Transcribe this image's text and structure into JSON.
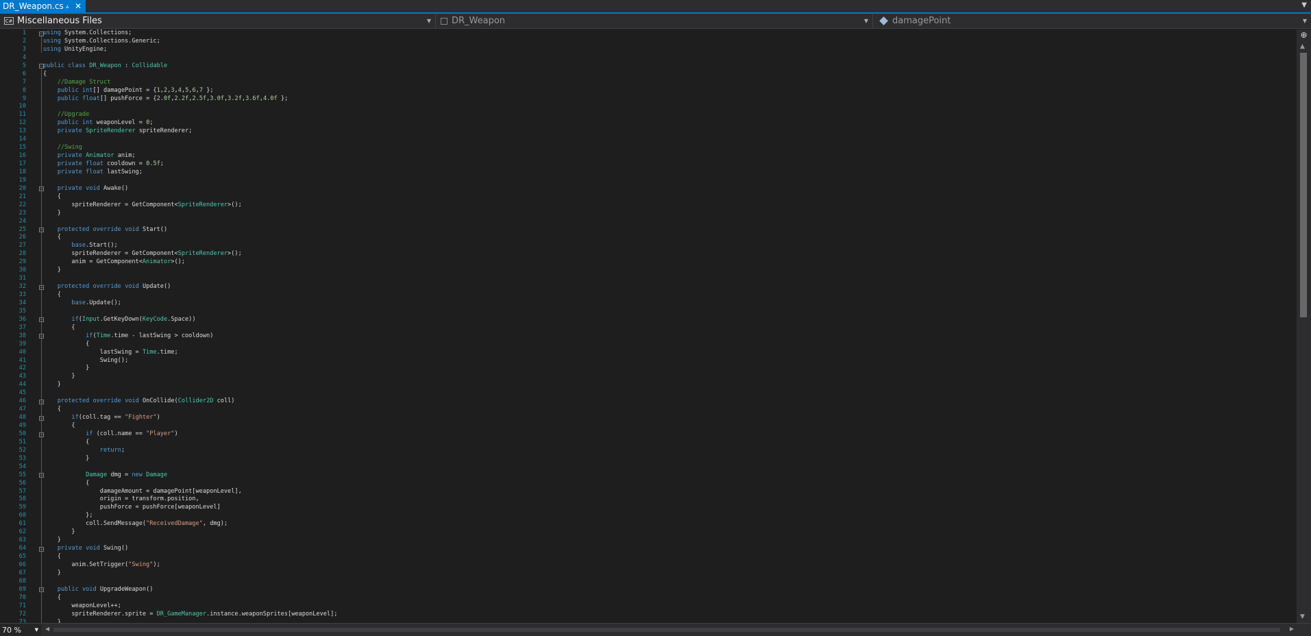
{
  "tab": {
    "title": "DR_Weapon.cs",
    "pin_icon": "pin-icon",
    "close_icon": "close-icon"
  },
  "nav": {
    "project": "Miscellaneous Files",
    "type": "DR_Weapon",
    "member": "damagePoint"
  },
  "zoom": {
    "value": "70 %"
  },
  "colors": {
    "accent": "#007acc",
    "keyword": "#569cd6",
    "type": "#4ec9b0",
    "comment": "#57a64a",
    "number": "#b5cea8",
    "string": "#d69d85",
    "line_number": "#2b91af"
  },
  "line_numbers": [
    "1",
    "2",
    "3",
    "4",
    "5",
    "6",
    "7",
    "8",
    "9",
    "10",
    "11",
    "12",
    "13",
    "14",
    "15",
    "16",
    "17",
    "18",
    "19",
    "20",
    "21",
    "22",
    "23",
    "24",
    "25",
    "26",
    "27",
    "28",
    "29",
    "30",
    "31",
    "32",
    "33",
    "34",
    "35",
    "36",
    "37",
    "38",
    "39",
    "40",
    "41",
    "42",
    "43",
    "44",
    "45",
    "46",
    "47",
    "48",
    "49",
    "50",
    "51",
    "52",
    "53",
    "54",
    "55",
    "56",
    "57",
    "58",
    "59",
    "60",
    "61",
    "62",
    "63",
    "64",
    "65",
    "66",
    "67",
    "68",
    "69",
    "70",
    "71",
    "72",
    "73"
  ],
  "code_lines": [
    [
      [
        "kw",
        "using"
      ],
      [
        "t",
        " System.Collections;"
      ]
    ],
    [
      [
        "kw",
        "using"
      ],
      [
        "t",
        " System.Collections.Generic;"
      ]
    ],
    [
      [
        "kw",
        "using"
      ],
      [
        "t",
        " UnityEngine;"
      ]
    ],
    [],
    [
      [
        "kw",
        "public"
      ],
      [
        "t",
        " "
      ],
      [
        "kw",
        "class"
      ],
      [
        "t",
        " "
      ],
      [
        "ty",
        "DR_Weapon"
      ],
      [
        "t",
        " : "
      ],
      [
        "ty",
        "Collidable"
      ]
    ],
    [
      [
        "t",
        "{"
      ]
    ],
    [
      [
        "t",
        "    "
      ],
      [
        "cm",
        "//Damage Struct"
      ]
    ],
    [
      [
        "t",
        "    "
      ],
      [
        "kw",
        "public"
      ],
      [
        "t",
        " "
      ],
      [
        "kw",
        "int"
      ],
      [
        "t",
        "[] damagePoint = {"
      ],
      [
        "nm",
        "1"
      ],
      [
        "t",
        ","
      ],
      [
        "nm",
        "2"
      ],
      [
        "t",
        ","
      ],
      [
        "nm",
        "3"
      ],
      [
        "t",
        ","
      ],
      [
        "nm",
        "4"
      ],
      [
        "t",
        ","
      ],
      [
        "nm",
        "5"
      ],
      [
        "t",
        ","
      ],
      [
        "nm",
        "6"
      ],
      [
        "t",
        ","
      ],
      [
        "nm",
        "7"
      ],
      [
        "t",
        " };"
      ]
    ],
    [
      [
        "t",
        "    "
      ],
      [
        "kw",
        "public"
      ],
      [
        "t",
        " "
      ],
      [
        "kw",
        "float"
      ],
      [
        "t",
        "[] pushForce = {"
      ],
      [
        "nm",
        "2.0f"
      ],
      [
        "t",
        ","
      ],
      [
        "nm",
        "2.2f"
      ],
      [
        "t",
        ","
      ],
      [
        "nm",
        "2.5f"
      ],
      [
        "t",
        ","
      ],
      [
        "nm",
        "3.0f"
      ],
      [
        "t",
        ","
      ],
      [
        "nm",
        "3.2f"
      ],
      [
        "t",
        ","
      ],
      [
        "nm",
        "3.6f"
      ],
      [
        "t",
        ","
      ],
      [
        "nm",
        "4.0f"
      ],
      [
        "t",
        " };"
      ]
    ],
    [],
    [
      [
        "t",
        "    "
      ],
      [
        "cm",
        "//Upgrade"
      ]
    ],
    [
      [
        "t",
        "    "
      ],
      [
        "kw",
        "public"
      ],
      [
        "t",
        " "
      ],
      [
        "kw",
        "int"
      ],
      [
        "t",
        " weaponLevel = "
      ],
      [
        "nm",
        "0"
      ],
      [
        "t",
        ";"
      ]
    ],
    [
      [
        "t",
        "    "
      ],
      [
        "kw",
        "private"
      ],
      [
        "t",
        " "
      ],
      [
        "ty",
        "SpriteRenderer"
      ],
      [
        "t",
        " spriteRenderer;"
      ]
    ],
    [],
    [
      [
        "t",
        "    "
      ],
      [
        "cm",
        "//Swing"
      ]
    ],
    [
      [
        "t",
        "    "
      ],
      [
        "kw",
        "private"
      ],
      [
        "t",
        " "
      ],
      [
        "ty",
        "Animator"
      ],
      [
        "t",
        " anim;"
      ]
    ],
    [
      [
        "t",
        "    "
      ],
      [
        "kw",
        "private"
      ],
      [
        "t",
        " "
      ],
      [
        "kw",
        "float"
      ],
      [
        "t",
        " cooldown = "
      ],
      [
        "nm",
        "0.5f"
      ],
      [
        "t",
        ";"
      ]
    ],
    [
      [
        "t",
        "    "
      ],
      [
        "kw",
        "private"
      ],
      [
        "t",
        " "
      ],
      [
        "kw",
        "float"
      ],
      [
        "t",
        " lastSwing;"
      ]
    ],
    [],
    [
      [
        "t",
        "    "
      ],
      [
        "kw",
        "private"
      ],
      [
        "t",
        " "
      ],
      [
        "kw",
        "void"
      ],
      [
        "t",
        " Awake()"
      ]
    ],
    [
      [
        "t",
        "    {"
      ]
    ],
    [
      [
        "t",
        "        spriteRenderer = GetComponent<"
      ],
      [
        "ty",
        "SpriteRenderer"
      ],
      [
        "t",
        ">();"
      ]
    ],
    [
      [
        "t",
        "    }"
      ]
    ],
    [],
    [
      [
        "t",
        "    "
      ],
      [
        "kw",
        "protected"
      ],
      [
        "t",
        " "
      ],
      [
        "kw",
        "override"
      ],
      [
        "t",
        " "
      ],
      [
        "kw",
        "void"
      ],
      [
        "t",
        " Start()"
      ]
    ],
    [
      [
        "t",
        "    {"
      ]
    ],
    [
      [
        "t",
        "        "
      ],
      [
        "kw",
        "base"
      ],
      [
        "t",
        ".Start();"
      ]
    ],
    [
      [
        "t",
        "        spriteRenderer = GetComponent<"
      ],
      [
        "ty",
        "SpriteRenderer"
      ],
      [
        "t",
        ">();"
      ]
    ],
    [
      [
        "t",
        "        anim = GetComponent<"
      ],
      [
        "ty",
        "Animator"
      ],
      [
        "t",
        ">();"
      ]
    ],
    [
      [
        "t",
        "    }"
      ]
    ],
    [],
    [
      [
        "t",
        "    "
      ],
      [
        "kw",
        "protected"
      ],
      [
        "t",
        " "
      ],
      [
        "kw",
        "override"
      ],
      [
        "t",
        " "
      ],
      [
        "kw",
        "void"
      ],
      [
        "t",
        " Update()"
      ]
    ],
    [
      [
        "t",
        "    {"
      ]
    ],
    [
      [
        "t",
        "        "
      ],
      [
        "kw",
        "base"
      ],
      [
        "t",
        ".Update();"
      ]
    ],
    [],
    [
      [
        "t",
        "        "
      ],
      [
        "kw",
        "if"
      ],
      [
        "t",
        "("
      ],
      [
        "ty",
        "Input"
      ],
      [
        "t",
        ".GetKeyDown("
      ],
      [
        "ty",
        "KeyCode"
      ],
      [
        "t",
        ".Space))"
      ]
    ],
    [
      [
        "t",
        "        {"
      ]
    ],
    [
      [
        "t",
        "            "
      ],
      [
        "kw",
        "if"
      ],
      [
        "t",
        "("
      ],
      [
        "ty",
        "Time"
      ],
      [
        "t",
        ".time - lastSwing > cooldown)"
      ]
    ],
    [
      [
        "t",
        "            {"
      ]
    ],
    [
      [
        "t",
        "                lastSwing = "
      ],
      [
        "ty",
        "Time"
      ],
      [
        "t",
        ".time;"
      ]
    ],
    [
      [
        "t",
        "                Swing();"
      ]
    ],
    [
      [
        "t",
        "            }"
      ]
    ],
    [
      [
        "t",
        "        }"
      ]
    ],
    [
      [
        "t",
        "    }"
      ]
    ],
    [],
    [
      [
        "t",
        "    "
      ],
      [
        "kw",
        "protected"
      ],
      [
        "t",
        " "
      ],
      [
        "kw",
        "override"
      ],
      [
        "t",
        " "
      ],
      [
        "kw",
        "void"
      ],
      [
        "t",
        " OnCollide("
      ],
      [
        "ty",
        "Collider2D"
      ],
      [
        "t",
        " coll)"
      ]
    ],
    [
      [
        "t",
        "    {"
      ]
    ],
    [
      [
        "t",
        "        "
      ],
      [
        "kw",
        "if"
      ],
      [
        "t",
        "(coll.tag == "
      ],
      [
        "st",
        "\"Fighter\""
      ],
      [
        "t",
        ")"
      ]
    ],
    [
      [
        "t",
        "        {"
      ]
    ],
    [
      [
        "t",
        "            "
      ],
      [
        "kw",
        "if"
      ],
      [
        "t",
        " (coll.name == "
      ],
      [
        "st",
        "\"Player\""
      ],
      [
        "t",
        ")"
      ]
    ],
    [
      [
        "t",
        "            {"
      ]
    ],
    [
      [
        "t",
        "                "
      ],
      [
        "kw",
        "return"
      ],
      [
        "t",
        ";"
      ]
    ],
    [
      [
        "t",
        "            }"
      ]
    ],
    [],
    [
      [
        "t",
        "            "
      ],
      [
        "ty",
        "Damage"
      ],
      [
        "t",
        " dmg = "
      ],
      [
        "kw",
        "new"
      ],
      [
        "t",
        " "
      ],
      [
        "ty",
        "Damage"
      ]
    ],
    [
      [
        "t",
        "            {"
      ]
    ],
    [
      [
        "t",
        "                damageAmount = damagePoint[weaponLevel],"
      ]
    ],
    [
      [
        "t",
        "                origin = transform.position,"
      ]
    ],
    [
      [
        "t",
        "                pushForce = pushForce[weaponLevel]"
      ]
    ],
    [
      [
        "t",
        "            };"
      ]
    ],
    [
      [
        "t",
        "            coll.SendMessage("
      ],
      [
        "st",
        "\"ReceivedDamage\""
      ],
      [
        "t",
        ", dmg);"
      ]
    ],
    [
      [
        "t",
        "        }"
      ]
    ],
    [
      [
        "t",
        "    }"
      ]
    ],
    [
      [
        "t",
        "    "
      ],
      [
        "kw",
        "private"
      ],
      [
        "t",
        " "
      ],
      [
        "kw",
        "void"
      ],
      [
        "t",
        " Swing()"
      ]
    ],
    [
      [
        "t",
        "    {"
      ]
    ],
    [
      [
        "t",
        "        anim.SetTrigger("
      ],
      [
        "st",
        "\"Swing\""
      ],
      [
        "t",
        ");"
      ]
    ],
    [
      [
        "t",
        "    }"
      ]
    ],
    [],
    [
      [
        "t",
        "    "
      ],
      [
        "kw",
        "public"
      ],
      [
        "t",
        " "
      ],
      [
        "kw",
        "void"
      ],
      [
        "t",
        " UpgradeWeapon()"
      ]
    ],
    [
      [
        "t",
        "    {"
      ]
    ],
    [
      [
        "t",
        "        weaponLevel++;"
      ]
    ],
    [
      [
        "t",
        "        spriteRenderer.sprite = "
      ],
      [
        "ty",
        "DR_GameManager"
      ],
      [
        "t",
        ".instance.weaponSprites[weaponLevel];"
      ]
    ],
    [
      [
        "t",
        "    }"
      ]
    ]
  ],
  "fold_markers": [
    1,
    5,
    20,
    25,
    32,
    36,
    38,
    46,
    48,
    50,
    55,
    64,
    69
  ]
}
